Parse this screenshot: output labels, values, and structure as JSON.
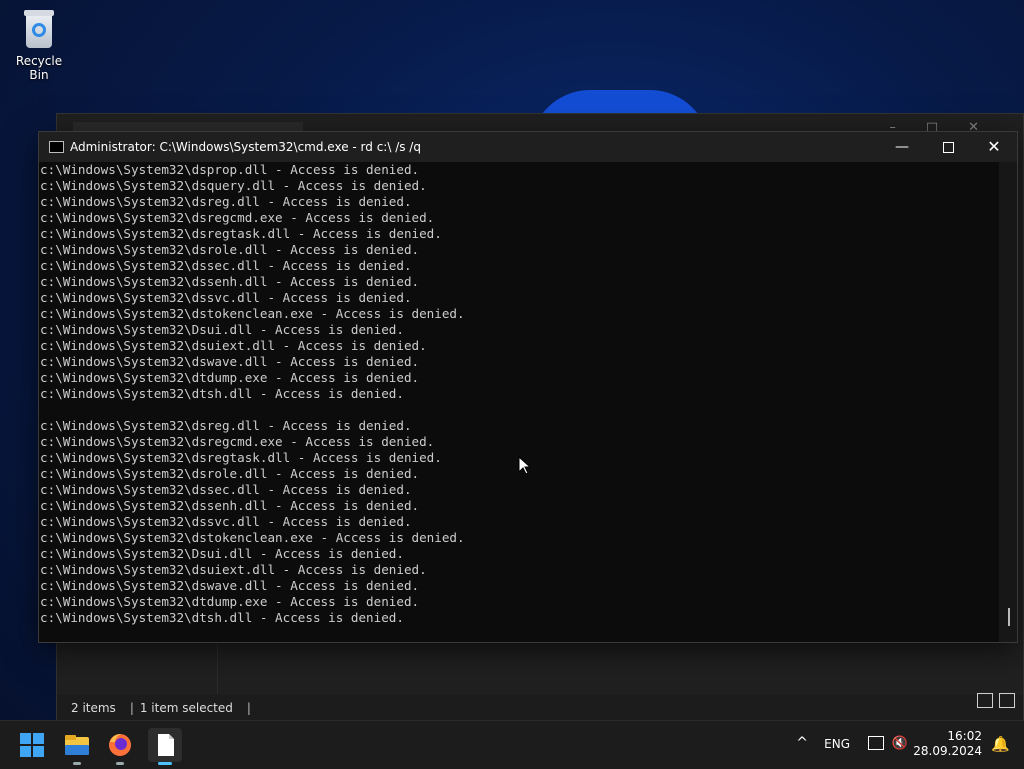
{
  "desktop": {
    "recycle_bin_label": "Recycle Bin"
  },
  "explorer": {
    "status_items": "2 items",
    "status_selected": "1 item selected",
    "status_sep": "|"
  },
  "cmd": {
    "title": "Administrator: C:\\Windows\\System32\\cmd.exe - rd  c:\\ /s /q",
    "controls": {
      "minimize": "—",
      "close": "✕"
    },
    "lines": [
      "c:\\Windows\\System32\\dsprop.dll - Access is denied.",
      "c:\\Windows\\System32\\dsquery.dll - Access is denied.",
      "c:\\Windows\\System32\\dsreg.dll - Access is denied.",
      "c:\\Windows\\System32\\dsregcmd.exe - Access is denied.",
      "c:\\Windows\\System32\\dsregtask.dll - Access is denied.",
      "c:\\Windows\\System32\\dsrole.dll - Access is denied.",
      "c:\\Windows\\System32\\dssec.dll - Access is denied.",
      "c:\\Windows\\System32\\dssenh.dll - Access is denied.",
      "c:\\Windows\\System32\\dssvc.dll - Access is denied.",
      "c:\\Windows\\System32\\dstokenclean.exe - Access is denied.",
      "c:\\Windows\\System32\\Dsui.dll - Access is denied.",
      "c:\\Windows\\System32\\dsuiext.dll - Access is denied.",
      "c:\\Windows\\System32\\dswave.dll - Access is denied.",
      "c:\\Windows\\System32\\dtdump.exe - Access is denied.",
      "c:\\Windows\\System32\\dtsh.dll - Access is denied.",
      "",
      "c:\\Windows\\System32\\dsreg.dll - Access is denied.",
      "c:\\Windows\\System32\\dsregcmd.exe - Access is denied.",
      "c:\\Windows\\System32\\dsregtask.dll - Access is denied.",
      "c:\\Windows\\System32\\dsrole.dll - Access is denied.",
      "c:\\Windows\\System32\\dssec.dll - Access is denied.",
      "c:\\Windows\\System32\\dssenh.dll - Access is denied.",
      "c:\\Windows\\System32\\dssvc.dll - Access is denied.",
      "c:\\Windows\\System32\\dstokenclean.exe - Access is denied.",
      "c:\\Windows\\System32\\Dsui.dll - Access is denied.",
      "c:\\Windows\\System32\\dsuiext.dll - Access is denied.",
      "c:\\Windows\\System32\\dswave.dll - Access is denied.",
      "c:\\Windows\\System32\\dtdump.exe - Access is denied.",
      "c:\\Windows\\System32\\dtsh.dll - Access is denied."
    ]
  },
  "taskbar": {
    "apps": [
      "start-icon",
      "file-explorer-icon",
      "firefox-icon",
      "notepad-icon"
    ],
    "tray": {
      "chevron": "^",
      "language": "ENG",
      "time": "16:02",
      "date": "28.09.2024"
    }
  }
}
